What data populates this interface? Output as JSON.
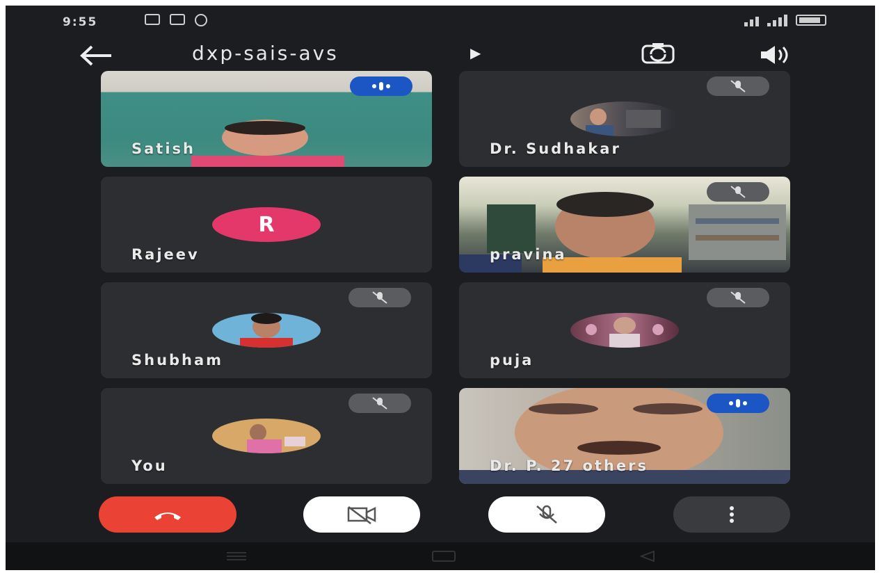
{
  "status_bar": {
    "time": "9:55"
  },
  "header": {
    "title": "dxp-sais-avs",
    "back_icon": "arrow-left-icon",
    "caret_icon": "caret-right-icon",
    "switch_camera_icon": "switch-camera-icon",
    "speaker_icon": "speaker-icon"
  },
  "participants": [
    {
      "name": "Satish",
      "state": "speaking",
      "media": "video"
    },
    {
      "name": "Dr. Sudhakar",
      "state": "muted",
      "media": "photo-avatar"
    },
    {
      "name": "Rajeev",
      "state": "none",
      "media": "letter-avatar",
      "initial": "R"
    },
    {
      "name": "pravina",
      "state": "muted",
      "media": "video"
    },
    {
      "name": "Shubham",
      "state": "muted",
      "media": "photo-avatar"
    },
    {
      "name": "puja",
      "state": "muted",
      "media": "photo-avatar"
    },
    {
      "name": "You",
      "state": "muted",
      "media": "photo-avatar"
    },
    {
      "name": "Dr. P.  27 others",
      "state": "speaking",
      "media": "video"
    }
  ],
  "controls": {
    "end_call_icon": "phone-hangup-icon",
    "camera_off_icon": "video-off-icon",
    "mic_off_icon": "mic-off-icon",
    "more_icon": "more-vertical-icon"
  },
  "colors": {
    "end_call": "#ea4335",
    "speaking_badge": "#1b56c4",
    "letter_avatar": "#e4386b",
    "background": "#1c1d20",
    "tile": "#2d2e31"
  }
}
